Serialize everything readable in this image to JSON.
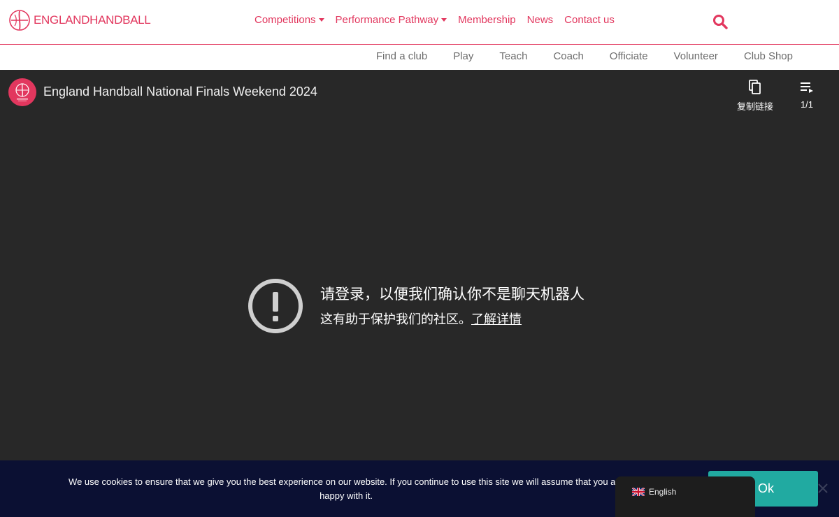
{
  "header": {
    "logo_text_a": "ENGLAND",
    "logo_text_b": "HANDBALL",
    "nav": [
      {
        "label": "Competitions",
        "dropdown": true
      },
      {
        "label": "Performance Pathway",
        "dropdown": true
      },
      {
        "label": "Membership",
        "dropdown": false
      },
      {
        "label": "News",
        "dropdown": false
      },
      {
        "label": "Contact us",
        "dropdown": false
      }
    ],
    "search_icon": "search-icon",
    "accent_color": "#e2375e"
  },
  "subnav": {
    "items": [
      "Find a club",
      "Play",
      "Teach",
      "Coach",
      "Officiate",
      "Volunteer",
      "Club Shop"
    ]
  },
  "player": {
    "title": "England Handball National Finals Weekend 2024",
    "copy_link_label": "复制链接",
    "playlist_count": "1/1",
    "error_title": "请登录，以便我们确认你不是聊天机器人",
    "error_subtitle": "这有助于保护我们的社区。",
    "error_link": "了解详情",
    "background": "#282828"
  },
  "cookie_banner": {
    "text": "We use cookies to ensure that we give you the best experience on our website. If you continue to use this site we will assume that you are happy with it.",
    "ok_label": "Ok",
    "ok_color": "#21aaa1"
  },
  "language": {
    "label": "English",
    "flag_icon": "uk-flag-icon"
  }
}
